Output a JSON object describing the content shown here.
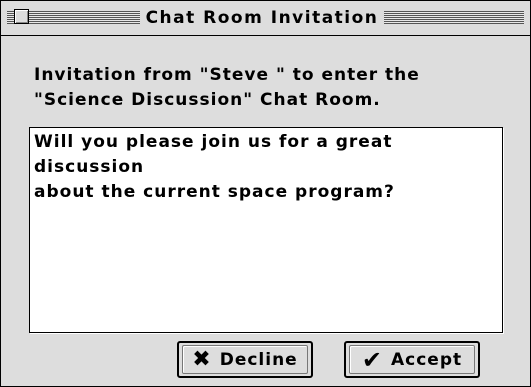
{
  "window": {
    "title": "Chat Room Invitation"
  },
  "invitation": {
    "text": "Invitation from \"Steve \" to enter the\n\"Science Discussion\" Chat Room."
  },
  "message": {
    "text": "Will you please join us for a great discussion\nabout the current space program?"
  },
  "buttons": {
    "decline_label": "Decline",
    "accept_label": "Accept"
  },
  "icons": {
    "decline": "close-x-icon",
    "accept": "checkmark-icon",
    "titlebar": "close-box-icon"
  },
  "colors": {
    "window_bg": "#dddddd",
    "message_bg": "#ffffff",
    "text": "#000000"
  }
}
